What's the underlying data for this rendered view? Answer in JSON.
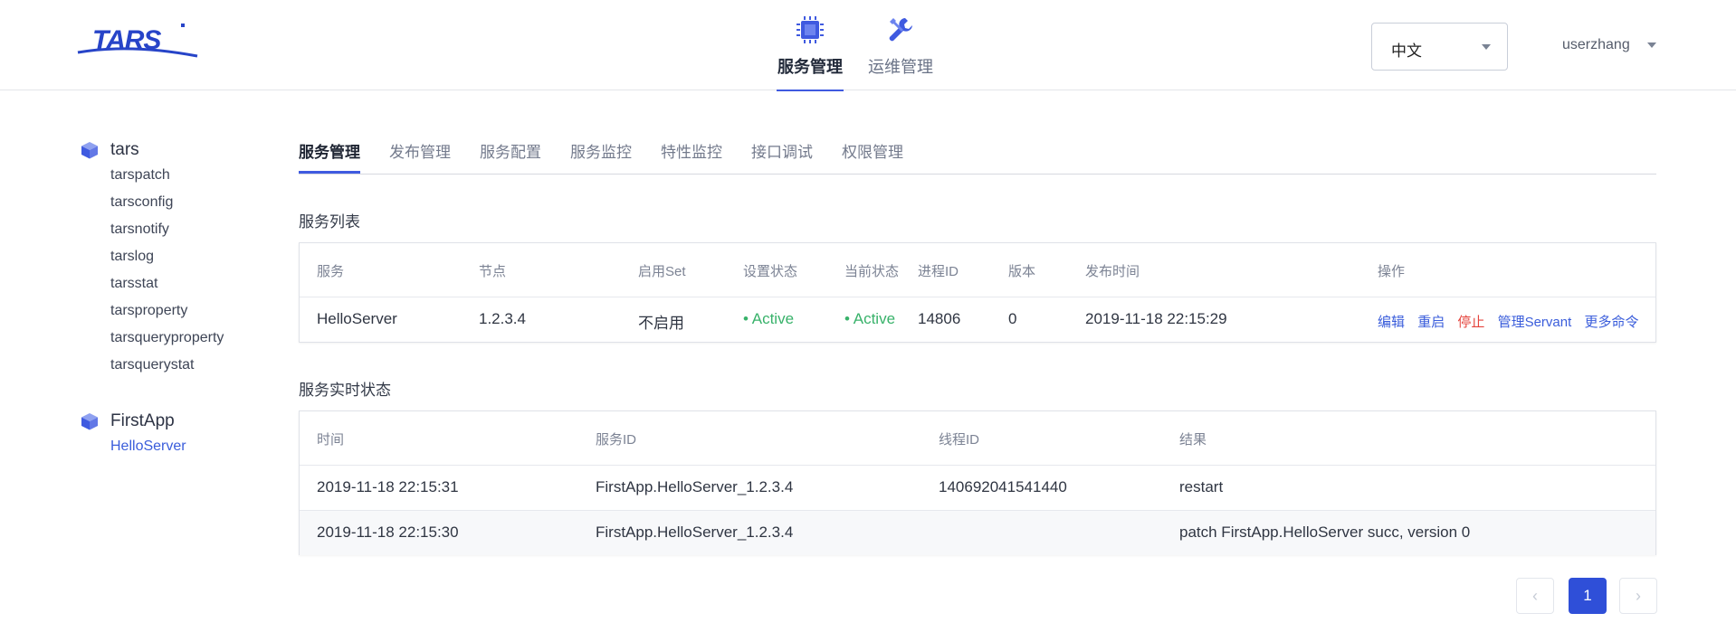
{
  "brand": {
    "logo_text": "TARS",
    "accent": "#3f5ae0"
  },
  "header": {
    "nav": [
      {
        "label": "服务管理",
        "icon": "chip-icon",
        "active": true
      },
      {
        "label": "运维管理",
        "icon": "wrench-icon",
        "active": false
      }
    ],
    "language": {
      "selected": "中文"
    },
    "user": {
      "name": "userzhang"
    }
  },
  "sidebar": {
    "groups": [
      {
        "app": "tars",
        "servers": [
          "tarspatch",
          "tarsconfig",
          "tarsnotify",
          "tarslog",
          "tarsstat",
          "tarsproperty",
          "tarsqueryproperty",
          "tarsquerystat"
        ]
      },
      {
        "app": "FirstApp",
        "servers": [
          "HelloServer"
        ],
        "active_server": "HelloServer"
      }
    ]
  },
  "tabs": [
    "服务管理",
    "发布管理",
    "服务配置",
    "服务监控",
    "特性监控",
    "接口调试",
    "权限管理"
  ],
  "service_list": {
    "title": "服务列表",
    "headers": [
      "服务",
      "节点",
      "启用Set",
      "设置状态",
      "当前状态",
      "进程ID",
      "版本",
      "发布时间",
      "操作"
    ],
    "rows": [
      {
        "service": "HelloServer",
        "node": "1.2.3.4",
        "set_enabled": "不启用",
        "setting_status": "Active",
        "current_status": "Active",
        "pid": "14806",
        "version": "0",
        "publish_time": "2019-11-18 22:15:29",
        "actions": [
          "编辑",
          "重启",
          "停止",
          "管理Servant",
          "更多命令"
        ]
      }
    ]
  },
  "realtime": {
    "title": "服务实时状态",
    "headers": [
      "时间",
      "服务ID",
      "线程ID",
      "结果"
    ],
    "rows": [
      {
        "time": "2019-11-18 22:15:31",
        "service_id": "FirstApp.HelloServer_1.2.3.4",
        "thread_id": "140692041541440",
        "result": "restart"
      },
      {
        "time": "2019-11-18 22:15:30",
        "service_id": "FirstApp.HelloServer_1.2.3.4",
        "thread_id": "",
        "result": "patch FirstApp.HelloServer succ, version 0"
      }
    ]
  },
  "pagination": {
    "prev": "‹",
    "current": "1",
    "next": "›"
  },
  "colors": {
    "active_status": "#38b26a",
    "danger": "#e5443d",
    "link": "#3a5ddb"
  }
}
